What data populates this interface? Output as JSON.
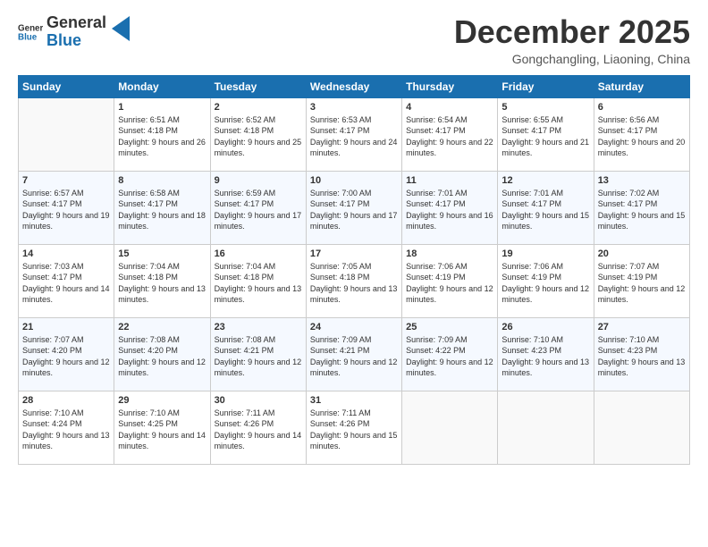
{
  "header": {
    "logo_general": "General",
    "logo_blue": "Blue",
    "month_title": "December 2025",
    "subtitle": "Gongchangling, Liaoning, China"
  },
  "days_of_week": [
    "Sunday",
    "Monday",
    "Tuesday",
    "Wednesday",
    "Thursday",
    "Friday",
    "Saturday"
  ],
  "weeks": [
    [
      {
        "day": "",
        "sunrise": "",
        "sunset": "",
        "daylight": ""
      },
      {
        "day": "1",
        "sunrise": "Sunrise: 6:51 AM",
        "sunset": "Sunset: 4:18 PM",
        "daylight": "Daylight: 9 hours and 26 minutes."
      },
      {
        "day": "2",
        "sunrise": "Sunrise: 6:52 AM",
        "sunset": "Sunset: 4:18 PM",
        "daylight": "Daylight: 9 hours and 25 minutes."
      },
      {
        "day": "3",
        "sunrise": "Sunrise: 6:53 AM",
        "sunset": "Sunset: 4:17 PM",
        "daylight": "Daylight: 9 hours and 24 minutes."
      },
      {
        "day": "4",
        "sunrise": "Sunrise: 6:54 AM",
        "sunset": "Sunset: 4:17 PM",
        "daylight": "Daylight: 9 hours and 22 minutes."
      },
      {
        "day": "5",
        "sunrise": "Sunrise: 6:55 AM",
        "sunset": "Sunset: 4:17 PM",
        "daylight": "Daylight: 9 hours and 21 minutes."
      },
      {
        "day": "6",
        "sunrise": "Sunrise: 6:56 AM",
        "sunset": "Sunset: 4:17 PM",
        "daylight": "Daylight: 9 hours and 20 minutes."
      }
    ],
    [
      {
        "day": "7",
        "sunrise": "Sunrise: 6:57 AM",
        "sunset": "Sunset: 4:17 PM",
        "daylight": "Daylight: 9 hours and 19 minutes."
      },
      {
        "day": "8",
        "sunrise": "Sunrise: 6:58 AM",
        "sunset": "Sunset: 4:17 PM",
        "daylight": "Daylight: 9 hours and 18 minutes."
      },
      {
        "day": "9",
        "sunrise": "Sunrise: 6:59 AM",
        "sunset": "Sunset: 4:17 PM",
        "daylight": "Daylight: 9 hours and 17 minutes."
      },
      {
        "day": "10",
        "sunrise": "Sunrise: 7:00 AM",
        "sunset": "Sunset: 4:17 PM",
        "daylight": "Daylight: 9 hours and 17 minutes."
      },
      {
        "day": "11",
        "sunrise": "Sunrise: 7:01 AM",
        "sunset": "Sunset: 4:17 PM",
        "daylight": "Daylight: 9 hours and 16 minutes."
      },
      {
        "day": "12",
        "sunrise": "Sunrise: 7:01 AM",
        "sunset": "Sunset: 4:17 PM",
        "daylight": "Daylight: 9 hours and 15 minutes."
      },
      {
        "day": "13",
        "sunrise": "Sunrise: 7:02 AM",
        "sunset": "Sunset: 4:17 PM",
        "daylight": "Daylight: 9 hours and 15 minutes."
      }
    ],
    [
      {
        "day": "14",
        "sunrise": "Sunrise: 7:03 AM",
        "sunset": "Sunset: 4:17 PM",
        "daylight": "Daylight: 9 hours and 14 minutes."
      },
      {
        "day": "15",
        "sunrise": "Sunrise: 7:04 AM",
        "sunset": "Sunset: 4:18 PM",
        "daylight": "Daylight: 9 hours and 13 minutes."
      },
      {
        "day": "16",
        "sunrise": "Sunrise: 7:04 AM",
        "sunset": "Sunset: 4:18 PM",
        "daylight": "Daylight: 9 hours and 13 minutes."
      },
      {
        "day": "17",
        "sunrise": "Sunrise: 7:05 AM",
        "sunset": "Sunset: 4:18 PM",
        "daylight": "Daylight: 9 hours and 13 minutes."
      },
      {
        "day": "18",
        "sunrise": "Sunrise: 7:06 AM",
        "sunset": "Sunset: 4:19 PM",
        "daylight": "Daylight: 9 hours and 12 minutes."
      },
      {
        "day": "19",
        "sunrise": "Sunrise: 7:06 AM",
        "sunset": "Sunset: 4:19 PM",
        "daylight": "Daylight: 9 hours and 12 minutes."
      },
      {
        "day": "20",
        "sunrise": "Sunrise: 7:07 AM",
        "sunset": "Sunset: 4:19 PM",
        "daylight": "Daylight: 9 hours and 12 minutes."
      }
    ],
    [
      {
        "day": "21",
        "sunrise": "Sunrise: 7:07 AM",
        "sunset": "Sunset: 4:20 PM",
        "daylight": "Daylight: 9 hours and 12 minutes."
      },
      {
        "day": "22",
        "sunrise": "Sunrise: 7:08 AM",
        "sunset": "Sunset: 4:20 PM",
        "daylight": "Daylight: 9 hours and 12 minutes."
      },
      {
        "day": "23",
        "sunrise": "Sunrise: 7:08 AM",
        "sunset": "Sunset: 4:21 PM",
        "daylight": "Daylight: 9 hours and 12 minutes."
      },
      {
        "day": "24",
        "sunrise": "Sunrise: 7:09 AM",
        "sunset": "Sunset: 4:21 PM",
        "daylight": "Daylight: 9 hours and 12 minutes."
      },
      {
        "day": "25",
        "sunrise": "Sunrise: 7:09 AM",
        "sunset": "Sunset: 4:22 PM",
        "daylight": "Daylight: 9 hours and 12 minutes."
      },
      {
        "day": "26",
        "sunrise": "Sunrise: 7:10 AM",
        "sunset": "Sunset: 4:23 PM",
        "daylight": "Daylight: 9 hours and 13 minutes."
      },
      {
        "day": "27",
        "sunrise": "Sunrise: 7:10 AM",
        "sunset": "Sunset: 4:23 PM",
        "daylight": "Daylight: 9 hours and 13 minutes."
      }
    ],
    [
      {
        "day": "28",
        "sunrise": "Sunrise: 7:10 AM",
        "sunset": "Sunset: 4:24 PM",
        "daylight": "Daylight: 9 hours and 13 minutes."
      },
      {
        "day": "29",
        "sunrise": "Sunrise: 7:10 AM",
        "sunset": "Sunset: 4:25 PM",
        "daylight": "Daylight: 9 hours and 14 minutes."
      },
      {
        "day": "30",
        "sunrise": "Sunrise: 7:11 AM",
        "sunset": "Sunset: 4:26 PM",
        "daylight": "Daylight: 9 hours and 14 minutes."
      },
      {
        "day": "31",
        "sunrise": "Sunrise: 7:11 AM",
        "sunset": "Sunset: 4:26 PM",
        "daylight": "Daylight: 9 hours and 15 minutes."
      },
      {
        "day": "",
        "sunrise": "",
        "sunset": "",
        "daylight": ""
      },
      {
        "day": "",
        "sunrise": "",
        "sunset": "",
        "daylight": ""
      },
      {
        "day": "",
        "sunrise": "",
        "sunset": "",
        "daylight": ""
      }
    ]
  ]
}
